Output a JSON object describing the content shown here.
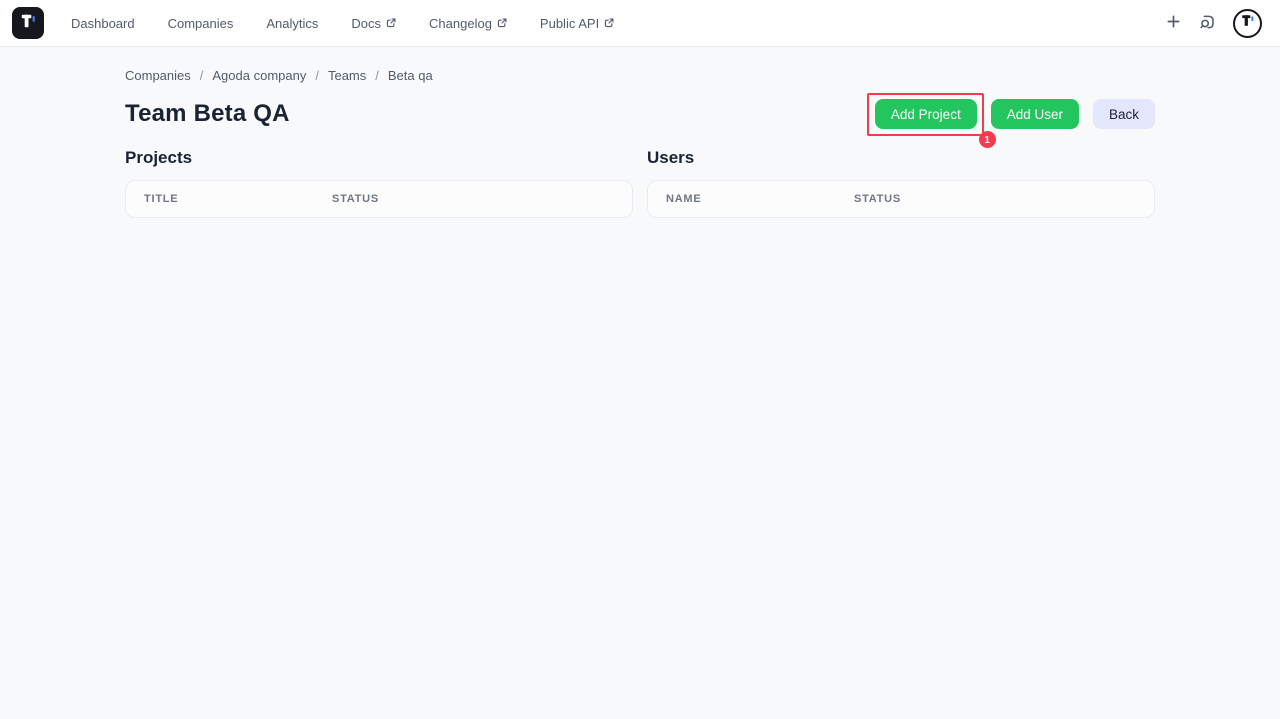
{
  "nav": {
    "logo_name": "app-logo",
    "items": [
      {
        "label": "Dashboard",
        "external": false
      },
      {
        "label": "Companies",
        "external": false
      },
      {
        "label": "Analytics",
        "external": false
      },
      {
        "label": "Docs",
        "external": true
      },
      {
        "label": "Changelog",
        "external": true
      },
      {
        "label": "Public API",
        "external": true
      }
    ]
  },
  "breadcrumb": {
    "separator": "/",
    "items": [
      "Companies",
      "Agoda company",
      "Teams",
      "Beta qa"
    ]
  },
  "page": {
    "title": "Team Beta QA"
  },
  "toolbar": {
    "add_project": "Add Project",
    "add_user": "Add User",
    "back": "Back"
  },
  "annotation": {
    "step_badge": "1"
  },
  "sections": {
    "projects": {
      "title": "Projects",
      "columns": [
        "Title",
        "Status"
      ],
      "rows": []
    },
    "users": {
      "title": "Users",
      "columns": [
        "Name",
        "Status"
      ],
      "rows": []
    }
  },
  "colors": {
    "accent_green": "#22c55e",
    "annotation_red": "#f23b4e",
    "back_button_bg": "#e4e7fb"
  }
}
